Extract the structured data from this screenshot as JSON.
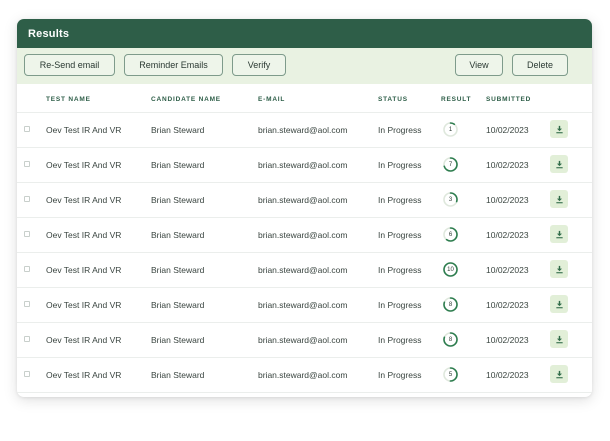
{
  "panel": {
    "title": "Results"
  },
  "toolbar": {
    "resend_label": "Re-Send email",
    "reminder_label": "Reminder Emails",
    "verify_label": "Verify",
    "view_label": "View",
    "delete_label": "Delete"
  },
  "table": {
    "columns": [
      "TEST NAME",
      "CANDIDATE NAME",
      "E-MAIL",
      "STATUS",
      "RESULT",
      "SUBMITTED"
    ],
    "rows": [
      {
        "test": "Oev Test IR And VR",
        "candidate": "Brian Steward",
        "email": "brian.steward@aol.com",
        "status": "In Progress",
        "result": "1",
        "submitted": "10/02/2023"
      },
      {
        "test": "Oev Test IR And VR",
        "candidate": "Brian Steward",
        "email": "brian.steward@aol.com",
        "status": "In Progress",
        "result": "7",
        "submitted": "10/02/2023"
      },
      {
        "test": "Oev Test IR And VR",
        "candidate": "Brian Steward",
        "email": "brian.steward@aol.com",
        "status": "In Progress",
        "result": "3",
        "submitted": "10/02/2023"
      },
      {
        "test": "Oev Test IR And VR",
        "candidate": "Brian Steward",
        "email": "brian.steward@aol.com",
        "status": "In Progress",
        "result": "6",
        "submitted": "10/02/2023"
      },
      {
        "test": "Oev Test IR And VR",
        "candidate": "Brian Steward",
        "email": "brian.steward@aol.com",
        "status": "In Progress",
        "result": "10",
        "submitted": "10/02/2023"
      },
      {
        "test": "Oev Test IR And VR",
        "candidate": "Brian Steward",
        "email": "brian.steward@aol.com",
        "status": "In Progress",
        "result": "8",
        "submitted": "10/02/2023"
      },
      {
        "test": "Oev Test IR And VR",
        "candidate": "Brian Steward",
        "email": "brian.steward@aol.com",
        "status": "In Progress",
        "result": "8",
        "submitted": "10/02/2023"
      },
      {
        "test": "Oev Test IR And VR",
        "candidate": "Brian Steward",
        "email": "brian.steward@aol.com",
        "status": "In Progress",
        "result": "5",
        "submitted": "10/02/2023"
      }
    ]
  },
  "icons": {
    "download": "download-icon",
    "checkbox": "checkbox-icon"
  },
  "colors": {
    "header_bg": "#2e5e48",
    "toolbar_bg": "#e9f2e2",
    "accent": "#2e7d4f",
    "download_bg": "#e2efd8"
  }
}
